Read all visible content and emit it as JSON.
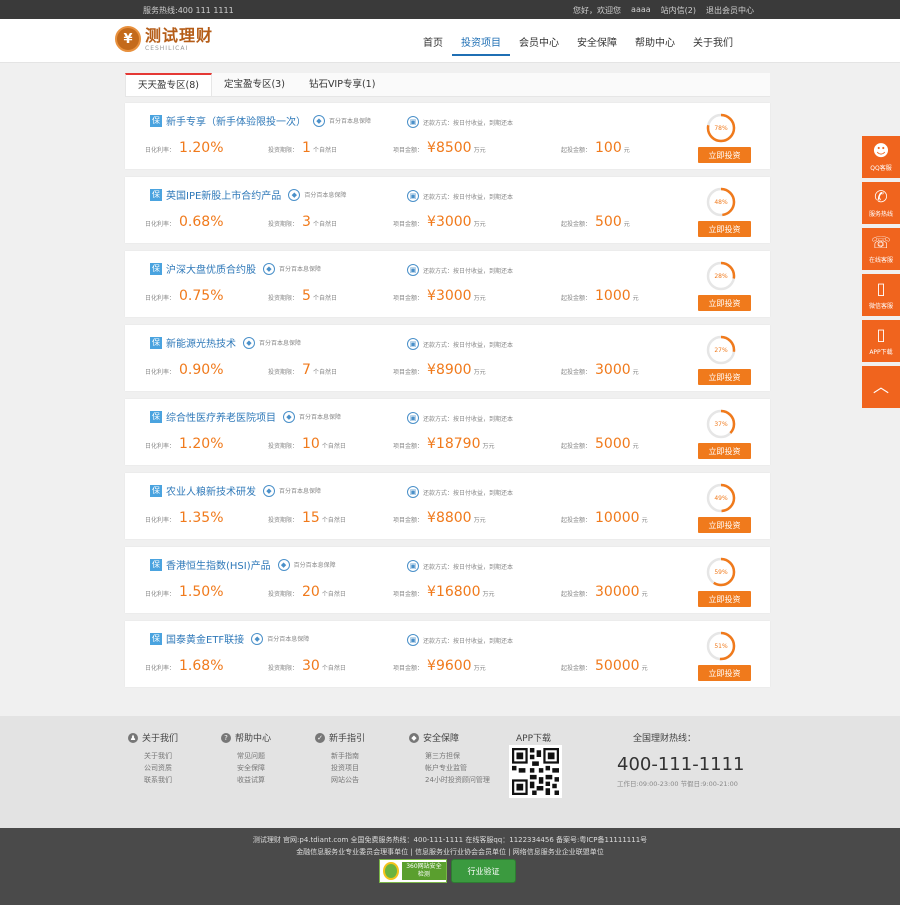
{
  "topbar": {
    "hotline": "服务热线:400 111 1111",
    "links": [
      "您好，欢迎您",
      "aaaa",
      "站内信(2)",
      "退出会员中心"
    ]
  },
  "logo": {
    "title": "测试理财",
    "subtitle": "CESHILICAI"
  },
  "nav": [
    "首页",
    "投资项目",
    "会员中心",
    "安全保障",
    "帮助中心",
    "关于我们"
  ],
  "nav_active": "投资项目",
  "tabs": [
    "天天盈专区(8)",
    "定宝盈专区(3)",
    "钻石VIP专享(1)"
  ],
  "labels": {
    "rate": "日化利率：",
    "term": "投资期限：",
    "amount": "项目金额：",
    "min": "起投金额：",
    "invest_btn": "立即投资",
    "yuan_sign": "¥"
  },
  "products": [
    {
      "name": "新手专享（新手体验限投一次）",
      "guarantee": "百分百本息保障",
      "repay": "还款方式：按日付收益，到期还本",
      "rate": "1.20%",
      "term": "1",
      "term_unit": "个自然日",
      "amount": "8500",
      "amount_unit": "万元",
      "min": "100",
      "min_unit": "元",
      "progress": "78%",
      "progress_value": 0.78
    },
    {
      "name": "英国IPE新股上市合约产品",
      "guarantee": "百分百本息保障",
      "repay": "还款方式：按日付收益，到期还本",
      "rate": "0.68%",
      "term": "3",
      "term_unit": "个自然日",
      "amount": "3000",
      "amount_unit": "万元",
      "min": "500",
      "min_unit": "元",
      "progress": "48%",
      "progress_value": 0.48
    },
    {
      "name": "沪深大盘优质合约股",
      "guarantee": "百分百本息保障",
      "repay": "还款方式：按日付收益，到期还本",
      "rate": "0.75%",
      "term": "5",
      "term_unit": "个自然日",
      "amount": "3000",
      "amount_unit": "万元",
      "min": "1000",
      "min_unit": "元",
      "progress": "28%",
      "progress_value": 0.28
    },
    {
      "name": "新能源光热技术",
      "guarantee": "百分百本息保障",
      "repay": "还款方式：按日付收益，到期还本",
      "rate": "0.90%",
      "term": "7",
      "term_unit": "个自然日",
      "amount": "8900",
      "amount_unit": "万元",
      "min": "3000",
      "min_unit": "元",
      "progress": "27%",
      "progress_value": 0.27
    },
    {
      "name": "综合性医疗养老医院项目",
      "guarantee": "百分百本息保障",
      "repay": "还款方式：按日付收益，到期还本",
      "rate": "1.20%",
      "term": "10",
      "term_unit": "个自然日",
      "amount": "18790",
      "amount_unit": "万元",
      "min": "5000",
      "min_unit": "元",
      "progress": "37%",
      "progress_value": 0.37
    },
    {
      "name": "农业人粮新技术研发",
      "guarantee": "百分百本息保障",
      "repay": "还款方式：按日付收益，到期还本",
      "rate": "1.35%",
      "term": "15",
      "term_unit": "个自然日",
      "amount": "8800",
      "amount_unit": "万元",
      "min": "10000",
      "min_unit": "元",
      "progress": "49%",
      "progress_value": 0.49
    },
    {
      "name": "香港恒生指数(HSI)产品",
      "guarantee": "百分百本息保障",
      "repay": "还款方式：按日付收益，到期还本",
      "rate": "1.50%",
      "term": "20",
      "term_unit": "个自然日",
      "amount": "16800",
      "amount_unit": "万元",
      "min": "30000",
      "min_unit": "元",
      "progress": "59%",
      "progress_value": 0.59
    },
    {
      "name": "国泰黄金ETF联接",
      "guarantee": "百分百本息保障",
      "repay": "还款方式：按日付收益，到期还本",
      "rate": "1.68%",
      "term": "30",
      "term_unit": "个自然日",
      "amount": "9600",
      "amount_unit": "万元",
      "min": "50000",
      "min_unit": "元",
      "progress": "51%",
      "progress_value": 0.51
    }
  ],
  "sidebar": [
    {
      "label": "QQ客服",
      "icon": "qq-icon",
      "glyph": "☻"
    },
    {
      "label": "服务热线",
      "icon": "phone-icon",
      "glyph": "✆"
    },
    {
      "label": "在线客服",
      "icon": "headset-icon",
      "glyph": "☏"
    },
    {
      "label": "微信客服",
      "icon": "wechat-icon",
      "glyph": "▯"
    },
    {
      "label": "APP下载",
      "icon": "mobile-icon",
      "glyph": "▯"
    },
    {
      "label": "",
      "icon": "back-to-top-icon",
      "glyph": "︿"
    }
  ],
  "footer": {
    "columns": [
      {
        "title": "关于我们",
        "glyph": "♟",
        "links": [
          "关于我们",
          "公司资质",
          "联系我们"
        ]
      },
      {
        "title": "帮助中心",
        "glyph": "?",
        "links": [
          "常见问题",
          "安全保障",
          "收益试算"
        ]
      },
      {
        "title": "新手指引",
        "glyph": "✓",
        "links": [
          "新手指南",
          "投资项目",
          "网站公告"
        ]
      },
      {
        "title": "安全保障",
        "glyph": "◆",
        "links": [
          "第三方担保",
          "帐户专业监管",
          "24小时投资顾问管理"
        ]
      }
    ],
    "app_title": "APP下载",
    "hotline_title": "全国理财热线：",
    "hotline_number": "400-111-1111",
    "work_time": "工作日:09:00-23:00 节假日:9:00-21:00"
  },
  "bottom": {
    "line1": "测试理财 官网:p4.tdiant.com 全国免费服务热线：400-111-1111 在线客服qq：1122334456 备案号:粤ICP备11111111号",
    "line2": "金融信息服务业专业委员会理事单位 | 信息服务业行业协会会员单位 | 网络信息服务业企业联盟单位",
    "badge1": "360网站安全检测",
    "badge2": "行业验证"
  },
  "colors": {
    "accent": "#f07a1c",
    "link": "#2f79b9",
    "nav_active": "#1f6fb4",
    "tab_active": "#e53935"
  }
}
